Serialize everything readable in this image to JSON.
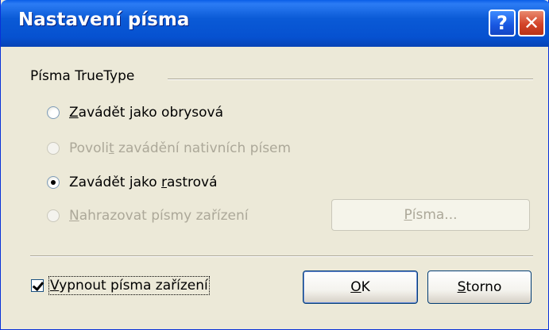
{
  "window": {
    "title": "Nastavení písma",
    "help_glyph": "?",
    "close_glyph": "✕"
  },
  "groupbox": {
    "label": "Písma TrueType"
  },
  "options": [
    {
      "pre": "",
      "u": "Z",
      "post": "avádět jako obrysová",
      "checked": false,
      "enabled": true
    },
    {
      "pre": "Povoli",
      "u": "t",
      "post": " zavádění nativních písem",
      "checked": false,
      "enabled": false
    },
    {
      "pre": "Zavádět jako ",
      "u": "r",
      "post": "astrová",
      "checked": true,
      "enabled": true
    },
    {
      "pre": "",
      "u": "N",
      "post": "ahrazovat písmy zařízení",
      "checked": false,
      "enabled": false
    }
  ],
  "fonts_button": {
    "u": "P",
    "post": "ísma..."
  },
  "checkbox": {
    "pre": "",
    "u": "V",
    "post": "ypnout písma zařízení",
    "checked": true
  },
  "ok_button": {
    "u": "O",
    "post": "K"
  },
  "cancel_button": {
    "u": "S",
    "post": "torno"
  }
}
